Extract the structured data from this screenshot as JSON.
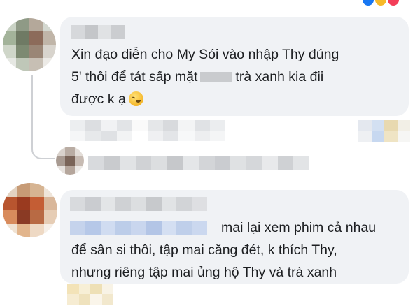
{
  "comments": [
    {
      "text_lines": [
        "Xin đạo diễn cho My Sói vào nhập Thy đúng",
        "5' thôi để tát sấp mặt",
        "trà xanh kia đii",
        "được k ạ"
      ],
      "emoji": "sneezing-face-icon"
    },
    {
      "text_lines": [
        "mai lại xem phim cả nhau",
        "để sân si thôi, tập mai căng đét, k thích Thy,",
        "nhưng riêng tập mai ủng hộ Thy và trà xanh"
      ]
    }
  ],
  "colors": {
    "bubble_bg": "#f0f2f5",
    "text": "#1c1e21",
    "thread_line": "#ced0d4",
    "blur_gray": "#dfe1e3",
    "blur_blue": "#c5d3ec"
  }
}
